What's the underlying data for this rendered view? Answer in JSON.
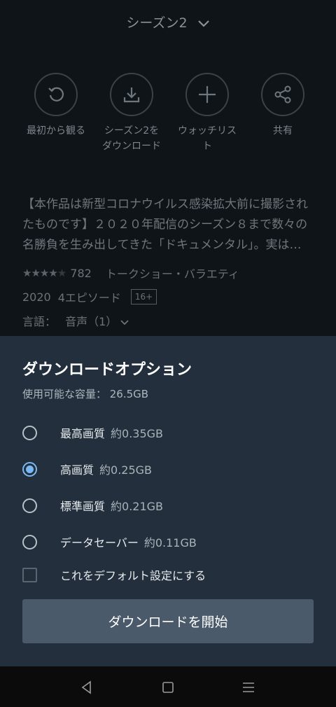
{
  "season": {
    "label": "シーズン2"
  },
  "actions": [
    {
      "icon": "restart-icon",
      "label": "最初から観る"
    },
    {
      "icon": "download-icon",
      "label": "シーズン2をダウンロード"
    },
    {
      "icon": "plus-icon",
      "label": "ウォッチリスト"
    },
    {
      "icon": "share-icon",
      "label": "共有"
    }
  ],
  "synopsis": "【本作品は新型コロナウイルス感染拡大前に撮影されたものです】２０２０年配信のシーズン８まで数々の名勝負を生み出してきた「ドキュメンタル」。実は…",
  "meta": {
    "rating": 4,
    "rating_count": "782",
    "genre": "トークショー・バラエティ",
    "year": "2020",
    "episodes": "4エピソード",
    "age": "16+",
    "language_label": "言語：",
    "audio": "音声（1）"
  },
  "sheet": {
    "title": "ダウンロードオプション",
    "capacity": "使用可能な容量： 26.5GB",
    "options": [
      {
        "label": "最高画質",
        "size": "約0.35GB",
        "selected": false
      },
      {
        "label": "高画質",
        "size": "約0.25GB",
        "selected": true
      },
      {
        "label": "標準画質",
        "size": "約0.21GB",
        "selected": false
      },
      {
        "label": "データセーバー",
        "size": "約0.11GB",
        "selected": false
      }
    ],
    "default_checkbox": "これをデフォルト設定にする",
    "start_button": "ダウンロードを開始"
  },
  "colors": {
    "accent": "#79b8f3",
    "sheet_bg": "#232f3d",
    "button_bg": "#4a5a6b"
  }
}
